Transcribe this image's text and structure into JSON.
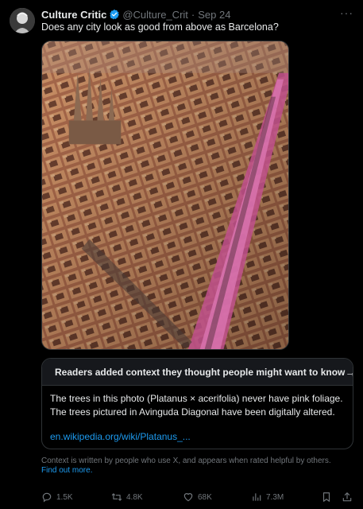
{
  "author": {
    "name": "Culture Critic",
    "handle": "@Culture_Crit",
    "separator": "·",
    "date": "Sep 24"
  },
  "tweet": {
    "text": "Does any city look as good from above as Barcelona?"
  },
  "community_note": {
    "title": "Readers added context they thought people might want to know",
    "body": "The trees in this photo (Platanus × acerifolia) never have pink foliage. The trees pictured in Avinguda Diagonal have been digitally altered.",
    "link": "en.wikipedia.org/wiki/Platanus_...",
    "disclaimer": "Context is written by people who use X, and appears when rated helpful by others.",
    "find_out_more": "Find out more."
  },
  "actions": {
    "replies": "1.5K",
    "reposts": "4.8K",
    "likes": "68K",
    "views": "7.3M"
  },
  "colors": {
    "background": "#000000",
    "text": "#e7e9ea",
    "muted": "#71767b",
    "link": "#1d9bf0",
    "border": "#2f3336",
    "note_header_bg": "#16181c"
  }
}
